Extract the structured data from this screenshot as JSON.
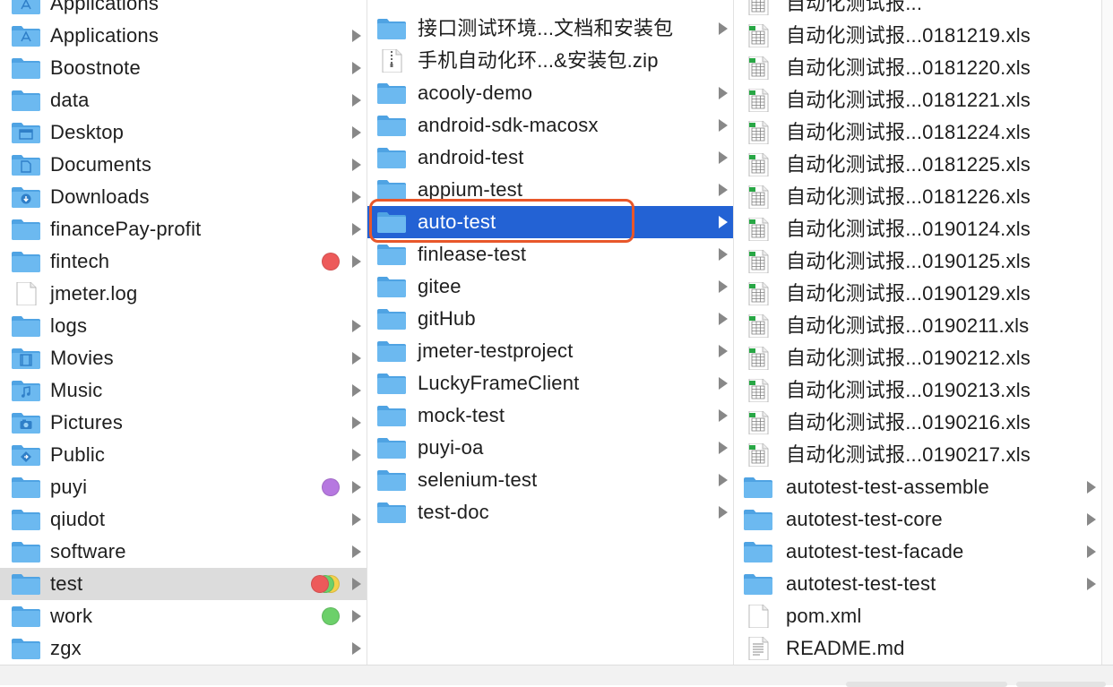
{
  "colors": {
    "selection": "#2362d4",
    "highlight_box": "#e8572a",
    "folder": "#6cb9f0",
    "tag_red": "#ed5a5a",
    "tag_purple": "#b678e0",
    "tag_green": "#6cd06a",
    "tag_yellow": "#f5d14a"
  },
  "column1": {
    "partial_top": "Applications",
    "items": [
      {
        "label": "Applications",
        "icon": "applications-folder-icon",
        "arrow": true
      },
      {
        "label": "Boostnote",
        "icon": "folder-icon",
        "arrow": true
      },
      {
        "label": "data",
        "icon": "folder-icon",
        "arrow": true
      },
      {
        "label": "Desktop",
        "icon": "desktop-folder-icon",
        "arrow": true
      },
      {
        "label": "Documents",
        "icon": "documents-folder-icon",
        "arrow": true
      },
      {
        "label": "Downloads",
        "icon": "downloads-folder-icon",
        "arrow": true
      },
      {
        "label": "financePay-profit",
        "icon": "folder-icon",
        "arrow": true
      },
      {
        "label": "fintech",
        "icon": "folder-icon",
        "arrow": true,
        "tags": [
          "red"
        ]
      },
      {
        "label": "jmeter.log",
        "icon": "document-icon",
        "arrow": false
      },
      {
        "label": "logs",
        "icon": "folder-icon",
        "arrow": true
      },
      {
        "label": "Movies",
        "icon": "movies-folder-icon",
        "arrow": true
      },
      {
        "label": "Music",
        "icon": "music-folder-icon",
        "arrow": true
      },
      {
        "label": "Pictures",
        "icon": "pictures-folder-icon",
        "arrow": true
      },
      {
        "label": "Public",
        "icon": "public-folder-icon",
        "arrow": true
      },
      {
        "label": "puyi",
        "icon": "folder-icon",
        "arrow": true,
        "tags": [
          "purple"
        ]
      },
      {
        "label": "qiudot",
        "icon": "folder-icon",
        "arrow": true
      },
      {
        "label": "software",
        "icon": "folder-icon",
        "arrow": true
      },
      {
        "label": "test",
        "icon": "folder-icon",
        "arrow": true,
        "tags": [
          "red",
          "green",
          "yellow"
        ],
        "state": "gray"
      },
      {
        "label": "work",
        "icon": "folder-icon",
        "arrow": true,
        "tags": [
          "green"
        ]
      },
      {
        "label": "zgx",
        "icon": "folder-icon",
        "arrow": true
      }
    ]
  },
  "column2": {
    "items": [
      {
        "label": "接口测试环境...文档和安装包",
        "icon": "folder-icon",
        "arrow": true
      },
      {
        "label": "手机自动化环...&安装包.zip",
        "icon": "zip-file-icon",
        "arrow": false
      },
      {
        "label": "acooly-demo",
        "icon": "folder-icon",
        "arrow": true
      },
      {
        "label": "android-sdk-macosx",
        "icon": "folder-icon",
        "arrow": true
      },
      {
        "label": "android-test",
        "icon": "folder-icon",
        "arrow": true
      },
      {
        "label": "appium-test",
        "icon": "folder-icon",
        "arrow": true
      },
      {
        "label": "auto-test",
        "icon": "folder-icon",
        "arrow": true,
        "state": "selected"
      },
      {
        "label": "finlease-test",
        "icon": "folder-icon",
        "arrow": true
      },
      {
        "label": "gitee",
        "icon": "folder-icon",
        "arrow": true
      },
      {
        "label": "gitHub",
        "icon": "folder-icon",
        "arrow": true
      },
      {
        "label": "jmeter-testproject",
        "icon": "folder-icon",
        "arrow": true
      },
      {
        "label": "LuckyFrameClient",
        "icon": "folder-icon",
        "arrow": true
      },
      {
        "label": "mock-test",
        "icon": "folder-icon",
        "arrow": true
      },
      {
        "label": "puyi-oa",
        "icon": "folder-icon",
        "arrow": true
      },
      {
        "label": "selenium-test",
        "icon": "folder-icon",
        "arrow": true
      },
      {
        "label": "test-doc",
        "icon": "folder-icon",
        "arrow": true
      }
    ]
  },
  "column3": {
    "partial_top": "自动化测试报...",
    "items": [
      {
        "label": "自动化测试报...0181219.xls",
        "icon": "spreadsheet-icon",
        "arrow": false
      },
      {
        "label": "自动化测试报...0181220.xls",
        "icon": "spreadsheet-icon",
        "arrow": false
      },
      {
        "label": "自动化测试报...0181221.xls",
        "icon": "spreadsheet-icon",
        "arrow": false
      },
      {
        "label": "自动化测试报...0181224.xls",
        "icon": "spreadsheet-icon",
        "arrow": false
      },
      {
        "label": "自动化测试报...0181225.xls",
        "icon": "spreadsheet-icon",
        "arrow": false
      },
      {
        "label": "自动化测试报...0181226.xls",
        "icon": "spreadsheet-icon",
        "arrow": false
      },
      {
        "label": "自动化测试报...0190124.xls",
        "icon": "spreadsheet-icon",
        "arrow": false
      },
      {
        "label": "自动化测试报...0190125.xls",
        "icon": "spreadsheet-icon",
        "arrow": false
      },
      {
        "label": "自动化测试报...0190129.xls",
        "icon": "spreadsheet-icon",
        "arrow": false
      },
      {
        "label": "自动化测试报...0190211.xls",
        "icon": "spreadsheet-icon",
        "arrow": false
      },
      {
        "label": "自动化测试报...0190212.xls",
        "icon": "spreadsheet-icon",
        "arrow": false
      },
      {
        "label": "自动化测试报...0190213.xls",
        "icon": "spreadsheet-icon",
        "arrow": false
      },
      {
        "label": "自动化测试报...0190216.xls",
        "icon": "spreadsheet-icon",
        "arrow": false
      },
      {
        "label": "自动化测试报...0190217.xls",
        "icon": "spreadsheet-icon",
        "arrow": false
      },
      {
        "label": "autotest-test-assemble",
        "icon": "folder-icon",
        "arrow": true
      },
      {
        "label": "autotest-test-core",
        "icon": "folder-icon",
        "arrow": true
      },
      {
        "label": "autotest-test-facade",
        "icon": "folder-icon",
        "arrow": true
      },
      {
        "label": "autotest-test-test",
        "icon": "folder-icon",
        "arrow": true
      },
      {
        "label": "pom.xml",
        "icon": "document-icon",
        "arrow": false
      },
      {
        "label": "README.md",
        "icon": "text-document-icon",
        "arrow": false
      }
    ]
  }
}
